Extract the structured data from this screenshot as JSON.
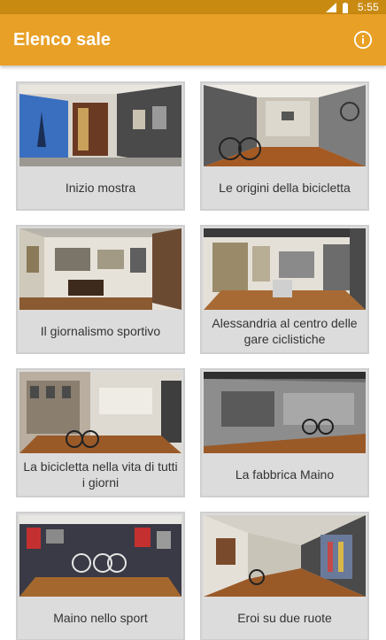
{
  "status_bar": {
    "time": "5:55",
    "icons": [
      "signal-icon",
      "battery-icon"
    ]
  },
  "app_bar": {
    "title": "Elenco sale",
    "info_icon": "info-icon"
  },
  "colors": {
    "primary": "#e8a026",
    "status_bar": "#c98a12",
    "card_bg": "#dcdcdc"
  },
  "rooms": [
    {
      "label": "Inizio mostra",
      "thumb": "room-photo"
    },
    {
      "label": "Le origini della bicicletta",
      "thumb": "room-photo"
    },
    {
      "label": "Il giornalismo sportivo",
      "thumb": "room-photo"
    },
    {
      "label": "Alessandria al centro delle gare ciclistiche",
      "thumb": "room-photo"
    },
    {
      "label": "La bicicletta nella vita di tutti i giorni",
      "thumb": "room-photo"
    },
    {
      "label": "La fabbrica Maino",
      "thumb": "room-photo"
    },
    {
      "label": "Maino nello sport",
      "thumb": "room-photo"
    },
    {
      "label": "Eroi su due ruote",
      "thumb": "room-photo"
    }
  ]
}
